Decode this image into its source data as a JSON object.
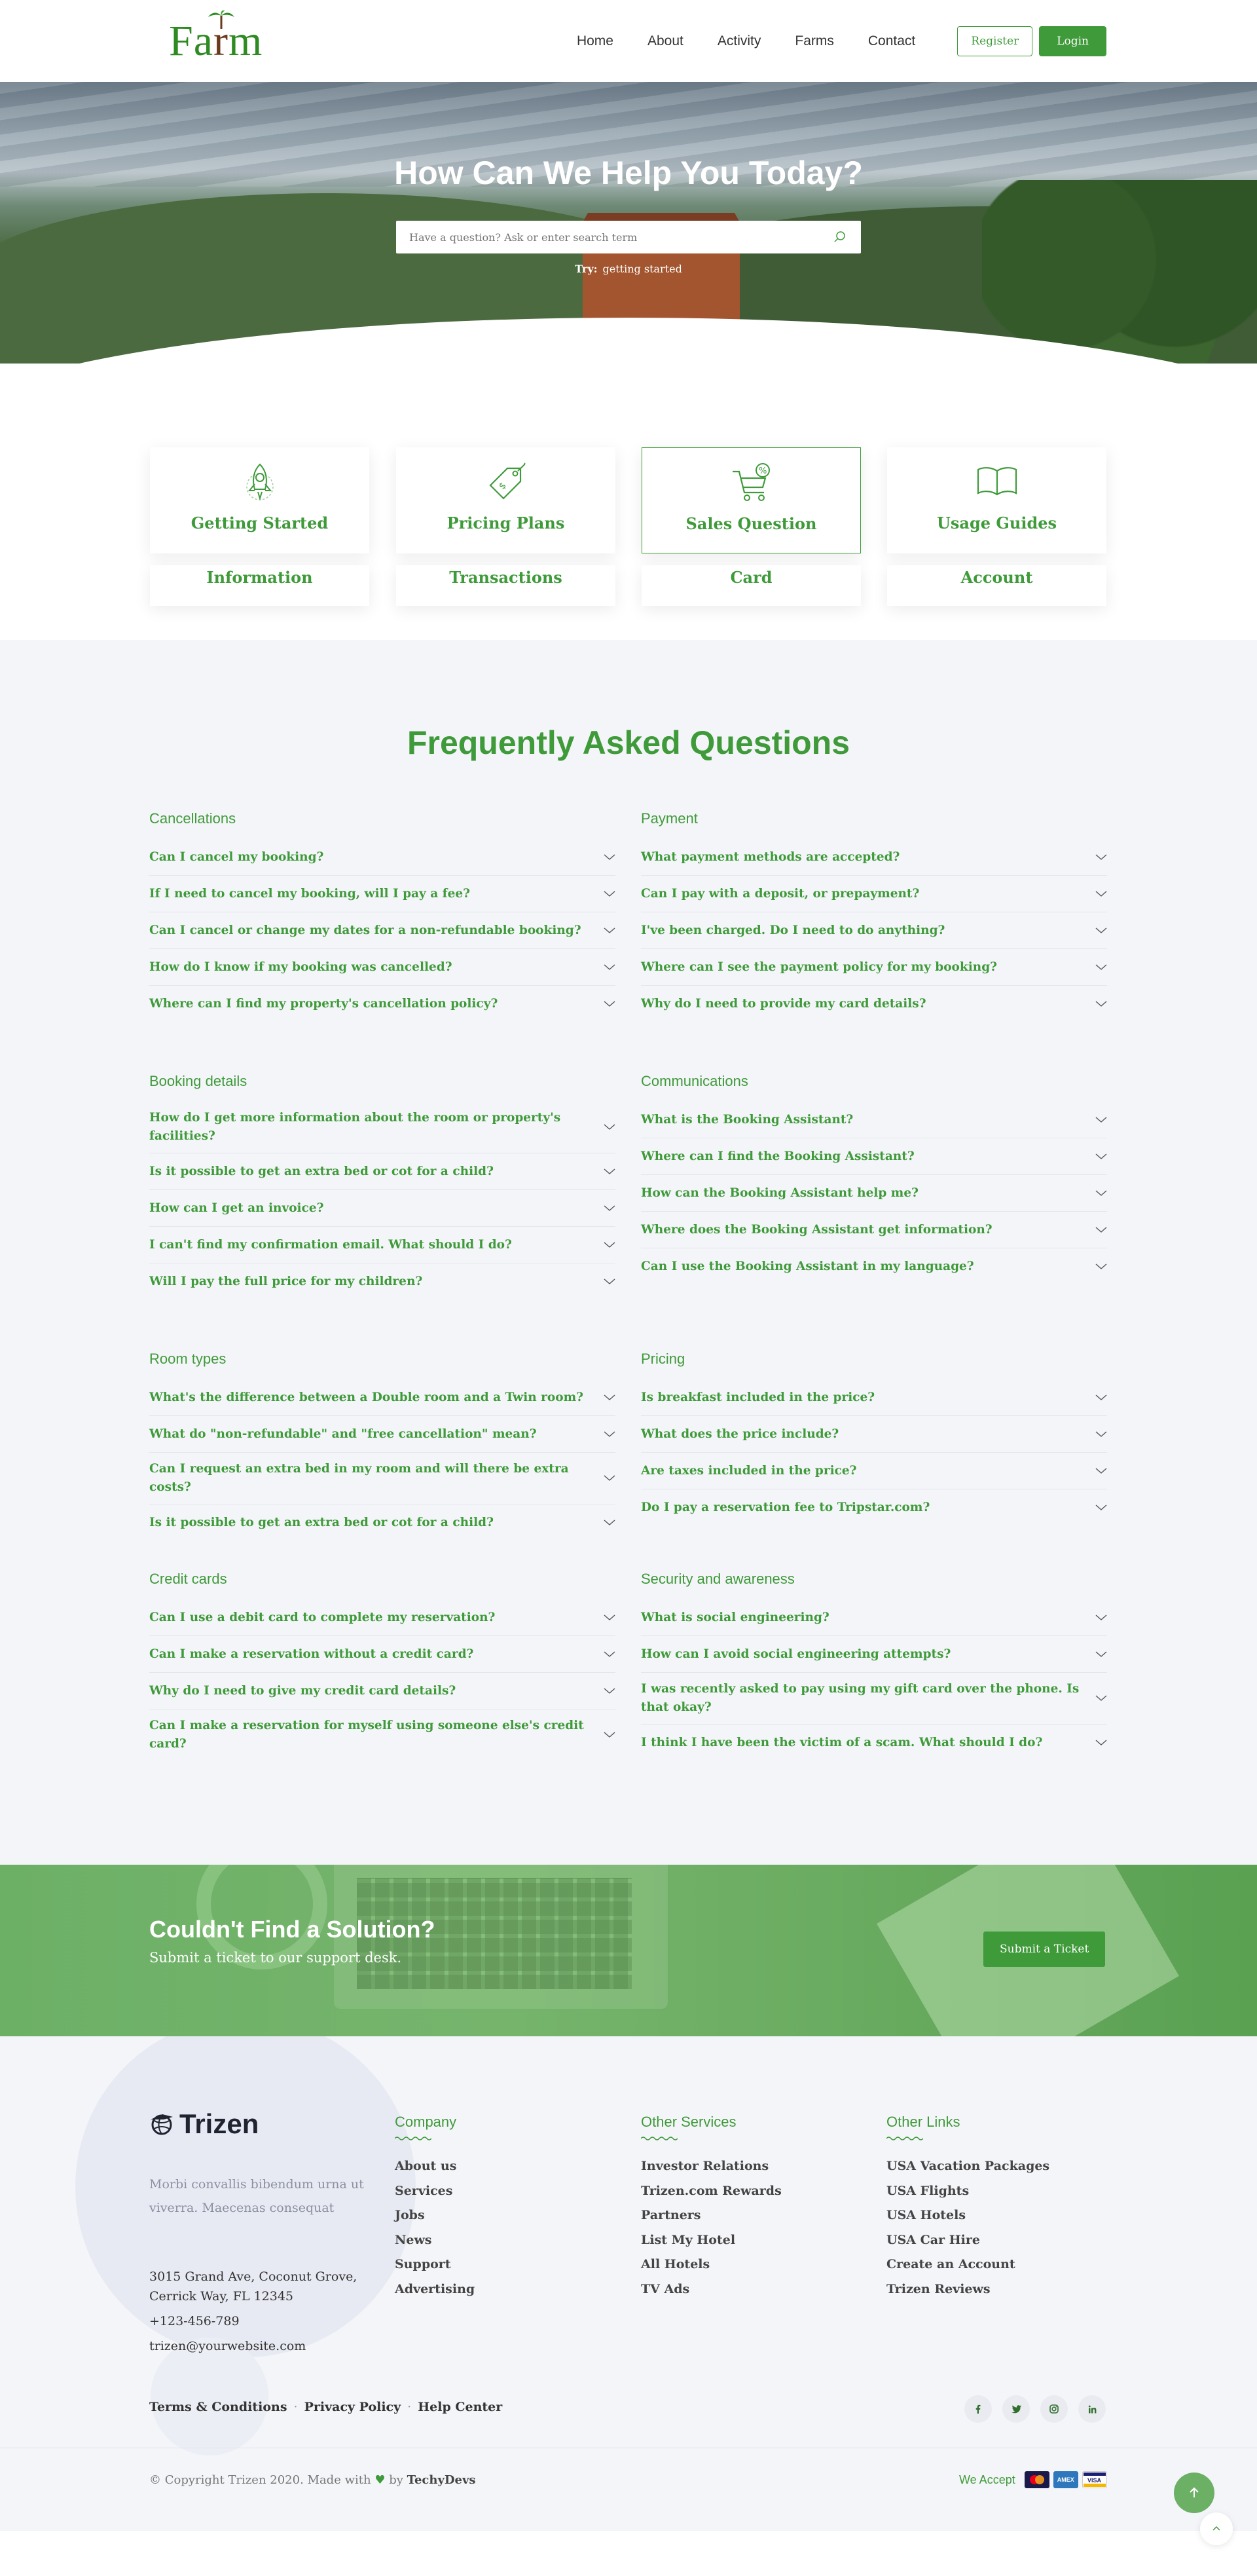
{
  "brand": {
    "logo_text_a": "Fa",
    "logo_text_r": "r",
    "logo_text_m": "m"
  },
  "nav": {
    "links": [
      "Home",
      "About",
      "Activity",
      "Farms",
      "Contact"
    ],
    "register": "Register",
    "login": "Login"
  },
  "hero": {
    "title": "How Can We Help You Today?",
    "search_placeholder": "Have a question? Ask or enter search term",
    "try_label": "Try:",
    "try_value": "getting started"
  },
  "categories": {
    "top": [
      {
        "label": "Getting Started",
        "icon": "rocket-icon"
      },
      {
        "label": "Pricing Plans",
        "icon": "price-tag-icon"
      },
      {
        "label": "Sales Question",
        "icon": "cart-discount-icon"
      },
      {
        "label": "Usage Guides",
        "icon": "book-icon"
      }
    ],
    "bottom": [
      "Information",
      "Transactions",
      "Card",
      "Account"
    ],
    "active_index": 2
  },
  "faq": {
    "title": "Frequently Asked Questions",
    "groups": [
      {
        "title": "Cancellations",
        "items": [
          "Can I cancel my booking?",
          "If I need to cancel my booking, will I pay a fee?",
          "Can I cancel or change my dates for a non-refundable booking?",
          "How do I know if my booking was cancelled?",
          "Where can I find my property's cancellation policy?"
        ]
      },
      {
        "title": "Payment",
        "items": [
          "What payment methods are accepted?",
          "Can I pay with a deposit, or prepayment?",
          "I've been charged. Do I need to do anything?",
          "Where can I see the payment policy for my booking?",
          "Why do I need to provide my card details?"
        ]
      },
      {
        "title": "Booking details",
        "items": [
          "How do I get more information about the room or property's facilities?",
          "Is it possible to get an extra bed or cot for a child?",
          "How can I get an invoice?",
          "I can't find my confirmation email. What should I do?",
          "Will I pay the full price for my children?"
        ]
      },
      {
        "title": "Communications",
        "items": [
          "What is the Booking Assistant?",
          "Where can I find the Booking Assistant?",
          "How can the Booking Assistant help me?",
          "Where does the Booking Assistant get information?",
          "Can I use the Booking Assistant in my language?"
        ]
      },
      {
        "title": "Room types",
        "items": [
          "What's the difference between a Double room and a Twin room?",
          "What do \"non-refundable\" and \"free cancellation\" mean?",
          "Can I request an extra bed in my room and will there be extra costs?",
          "Is it possible to get an extra bed or cot for a child?"
        ]
      },
      {
        "title": "Pricing",
        "items": [
          "Is breakfast included in the price?",
          "What does the price include?",
          "Are taxes included in the price?",
          "Do I pay a reservation fee to Tripstar.com?"
        ]
      },
      {
        "title": "Credit cards",
        "items": [
          "Can I use a debit card to complete my reservation?",
          "Can I make a reservation without a credit card?",
          "Why do I need to give my credit card details?",
          "Can I make a reservation for myself using someone else's credit card?"
        ]
      },
      {
        "title": "Security and awareness",
        "items": [
          "What is social engineering?",
          "How can I avoid social engineering attempts?",
          "I was recently asked to pay using my gift card over the phone. Is that okay?",
          "I think I have been the victim of a scam. What should I do?"
        ]
      }
    ]
  },
  "cta": {
    "title": "Couldn't Find a Solution?",
    "subtitle": "Submit a ticket to our support desk.",
    "button": "Submit a Ticket"
  },
  "footer": {
    "logo": "Trizen",
    "description": "Morbi convallis bibendum urna ut viverra. Maecenas consequat",
    "address": "3015 Grand Ave, Coconut Grove, Cerrick Way, FL 12345",
    "phone": "+123-456-789",
    "email": "trizen@yourwebsite.com",
    "columns": [
      {
        "title": "Company",
        "links": [
          "About us",
          "Services",
          "Jobs",
          "News",
          "Support",
          "Advertising"
        ]
      },
      {
        "title": "Other Services",
        "links": [
          "Investor Relations",
          "Trizen.com Rewards",
          "Partners",
          "List My Hotel",
          "All Hotels",
          "TV Ads"
        ]
      },
      {
        "title": "Other Links",
        "links": [
          "USA Vacation Packages",
          "USA Flights",
          "USA Hotels",
          "USA Car Hire",
          "Create an Account",
          "Trizen Reviews"
        ]
      }
    ],
    "bottom_links": [
      "Terms & Conditions",
      "Privacy Policy",
      "Help Center"
    ],
    "social_icons": [
      "facebook-icon",
      "twitter-icon",
      "instagram-icon",
      "linkedin-icon"
    ],
    "copyright_prefix": "© Copyright Trizen 2020. Made with",
    "copyright_by": "by",
    "copyright_author": "TechyDevs",
    "we_accept": "We Accept",
    "payment_icons": [
      "mastercard-icon",
      "amex-icon",
      "visa-icon"
    ]
  },
  "colors": {
    "accent": "#3f9a3a",
    "faq_bg": "#f4f5f9"
  }
}
